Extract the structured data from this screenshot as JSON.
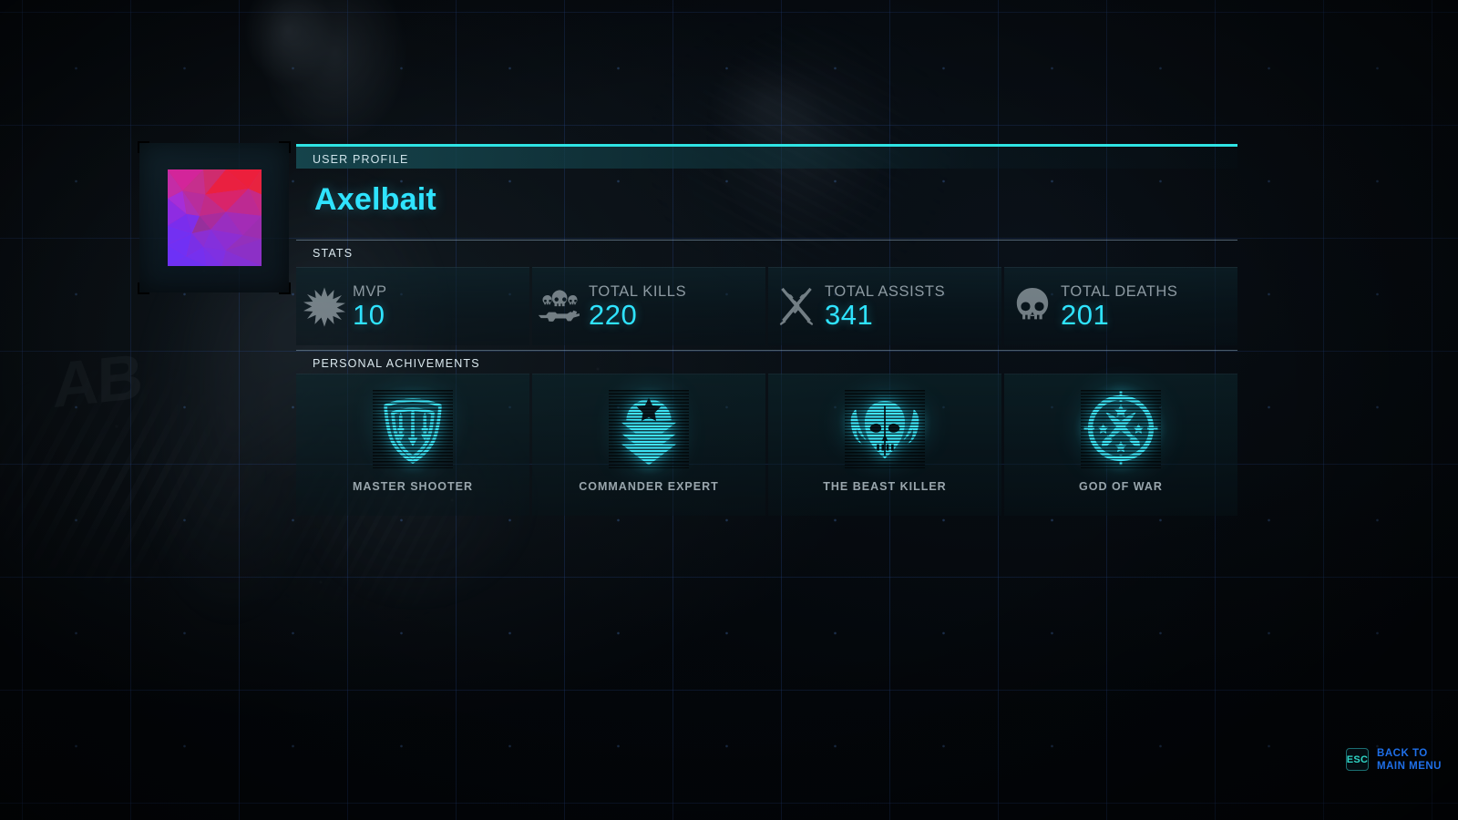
{
  "theme": {
    "accent_cyan": "#2fe3ff",
    "accent_teal": "#2fe3e3",
    "label_gray": "#8d9aa2",
    "link_blue": "#1f6fe8",
    "background": "#04070b"
  },
  "avatar": {
    "name": "player-avatar",
    "style": "low-poly-triangle-mosaic",
    "colors": [
      "#e8253f",
      "#d2269b",
      "#a62ed6",
      "#7b2ef0",
      "#6a2be8",
      "#c9248f"
    ]
  },
  "profile": {
    "section_label": "USER PROFILE",
    "player_name": "Axelbait"
  },
  "stats": {
    "section_label": "STATS",
    "items": [
      {
        "icon": "star-burst-icon",
        "label": "MVP",
        "value": "10"
      },
      {
        "icon": "skulls-rifle-icon",
        "label": "TOTAL KILLS",
        "value": "220"
      },
      {
        "icon": "crossed-rifles-icon",
        "label": "TOTAL ASSISTS",
        "value": "341"
      },
      {
        "icon": "skull-icon",
        "label": "TOTAL DEATHS",
        "value": "201"
      }
    ]
  },
  "achievements": {
    "section_label": "PERSONAL ACHIVEMENTS",
    "items": [
      {
        "icon": "shield-arrows-badge-icon",
        "label": "MASTER SHOOTER"
      },
      {
        "icon": "chevron-star-badge-icon",
        "label": "COMMANDER EXPERT"
      },
      {
        "icon": "winged-skull-badge-icon",
        "label": "THE BEAST KILLER"
      },
      {
        "icon": "crossed-swords-badge-icon",
        "label": "GOD OF WAR"
      }
    ]
  },
  "footer": {
    "key": "ESC",
    "action_line1": "BACK TO",
    "action_line2": "MAIN MENU"
  },
  "background": {
    "decor_text": "AB"
  }
}
